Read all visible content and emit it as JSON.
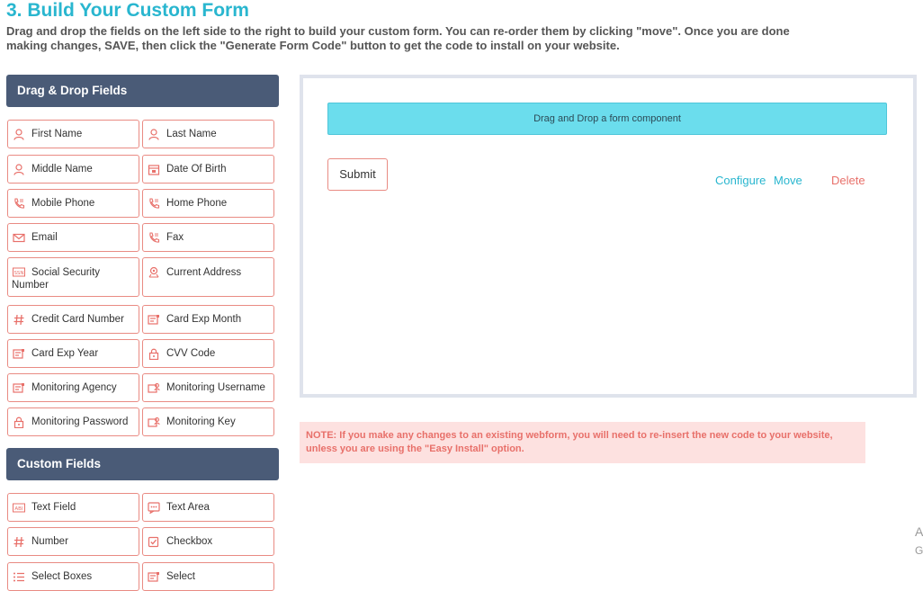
{
  "header": {
    "title": "3. Build Your Custom Form",
    "description": "Drag and drop the fields on the left side to the right to build your custom form.  You can re-order them by clicking \"move\".  Once you are done making changes, SAVE, then click the \"Generate Form Code\" button to get the code to install on your website."
  },
  "drag_drop": {
    "heading": "Drag & Drop Fields",
    "fields": [
      {
        "label": "First Name",
        "icon": "person-icon"
      },
      {
        "label": "Last Name",
        "icon": "person-icon"
      },
      {
        "label": "Middle Name",
        "icon": "person-icon"
      },
      {
        "label": "Date Of Birth",
        "icon": "calendar-icon"
      },
      {
        "label": "Mobile Phone",
        "icon": "phone-icon"
      },
      {
        "label": "Home Phone",
        "icon": "phone-icon"
      },
      {
        "label": "Email",
        "icon": "envelope-icon"
      },
      {
        "label": "Fax",
        "icon": "phone-icon"
      },
      {
        "label": "Social Security Number",
        "icon": "ssn-icon",
        "icon_text": "SSN"
      },
      {
        "label": "Current Address",
        "icon": "location-icon"
      },
      {
        "label": "Credit Card Number",
        "icon": "hash-icon"
      },
      {
        "label": "Card Exp Month",
        "icon": "card-icon"
      },
      {
        "label": "Card Exp Year",
        "icon": "card-icon"
      },
      {
        "label": "CVV Code",
        "icon": "lock-icon"
      },
      {
        "label": "Monitoring Agency",
        "icon": "card-icon"
      },
      {
        "label": "Monitoring Username",
        "icon": "user-card-icon"
      },
      {
        "label": "Monitoring Password",
        "icon": "lock-icon"
      },
      {
        "label": "Monitoring Key",
        "icon": "user-card-icon"
      }
    ]
  },
  "custom": {
    "heading": "Custom Fields",
    "fields": [
      {
        "label": "Text Field",
        "icon": "text-field-icon",
        "icon_text": "ABI"
      },
      {
        "label": "Text Area",
        "icon": "text-area-icon"
      },
      {
        "label": "Number",
        "icon": "hash-icon"
      },
      {
        "label": "Checkbox",
        "icon": "checkbox-icon"
      },
      {
        "label": "Select Boxes",
        "icon": "list-icon"
      },
      {
        "label": "Select",
        "icon": "card-icon"
      }
    ]
  },
  "canvas": {
    "dropzone_text": "Drag and Drop a form component",
    "submit_label": "Submit",
    "configure_label": "Configure",
    "move_label": "Move",
    "delete_label": "Delete"
  },
  "note": "NOTE: If you make any changes to an existing webform, you will need to re-insert the new code to your website, unless you are using the \"Easy Install\" option.",
  "edge_text": [
    "A",
    "G"
  ],
  "colors": {
    "accent": "#29b6cf",
    "panel_header": "#4a5b77",
    "field_border": "#e98b83",
    "icon": "#e8706a",
    "dropzone": "#6bdded",
    "note_bg": "#fde1e0"
  }
}
